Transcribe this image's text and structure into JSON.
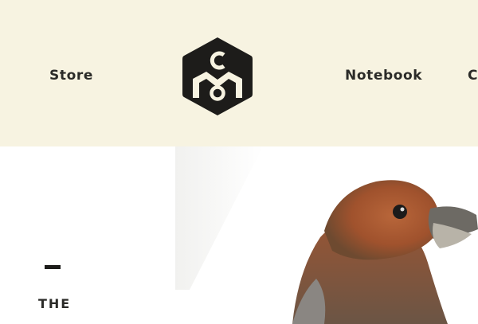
{
  "header": {
    "nav_left": {
      "label": "Store"
    },
    "nav_right": {
      "label": "Notebook"
    },
    "nav_cut": {
      "label": "C"
    },
    "logo": {
      "letters": [
        "C",
        "M",
        "O"
      ]
    }
  },
  "hero": {
    "title": "THE",
    "subtitle": "",
    "image": {
      "subject": "bird",
      "icon": "crossbill-bird-photo"
    }
  },
  "colors": {
    "header_bg": "#f7f3e1",
    "text": "#2b2b28",
    "logo": "#1d1c1a",
    "page_bg": "#ffffff"
  }
}
